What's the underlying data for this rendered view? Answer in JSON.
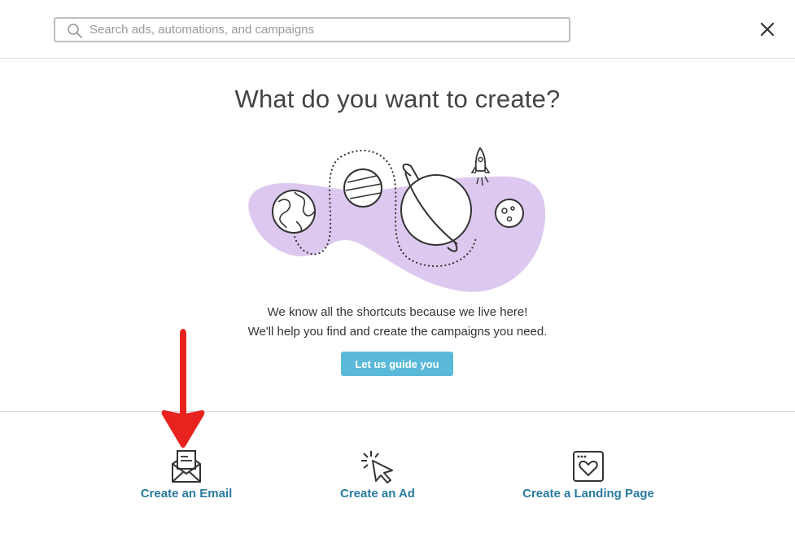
{
  "search": {
    "placeholder": "Search ads, automations, and campaigns",
    "icon": "search-icon"
  },
  "close_icon": "close-icon",
  "headline": "What do you want to create?",
  "illustration": {
    "icon": "space-planets-illustration",
    "blob_color": "#ddc9ef"
  },
  "intro": {
    "line1": "We know all the shortcuts because we live here!",
    "line2": "We'll help you find and create the campaigns you need."
  },
  "guide_button": {
    "label": "Let us guide you",
    "color": "#5ab9d8"
  },
  "options": [
    {
      "label": "Create an Email",
      "icon": "envelope-icon"
    },
    {
      "label": "Create an Ad",
      "icon": "cursor-click-icon"
    },
    {
      "label": "Create a Landing Page",
      "icon": "browser-heart-icon"
    }
  ],
  "annotation": {
    "icon": "red-arrow-pointer",
    "color": "#e8231f"
  },
  "colors": {
    "link": "#2a7aa0",
    "heading": "#444444"
  }
}
